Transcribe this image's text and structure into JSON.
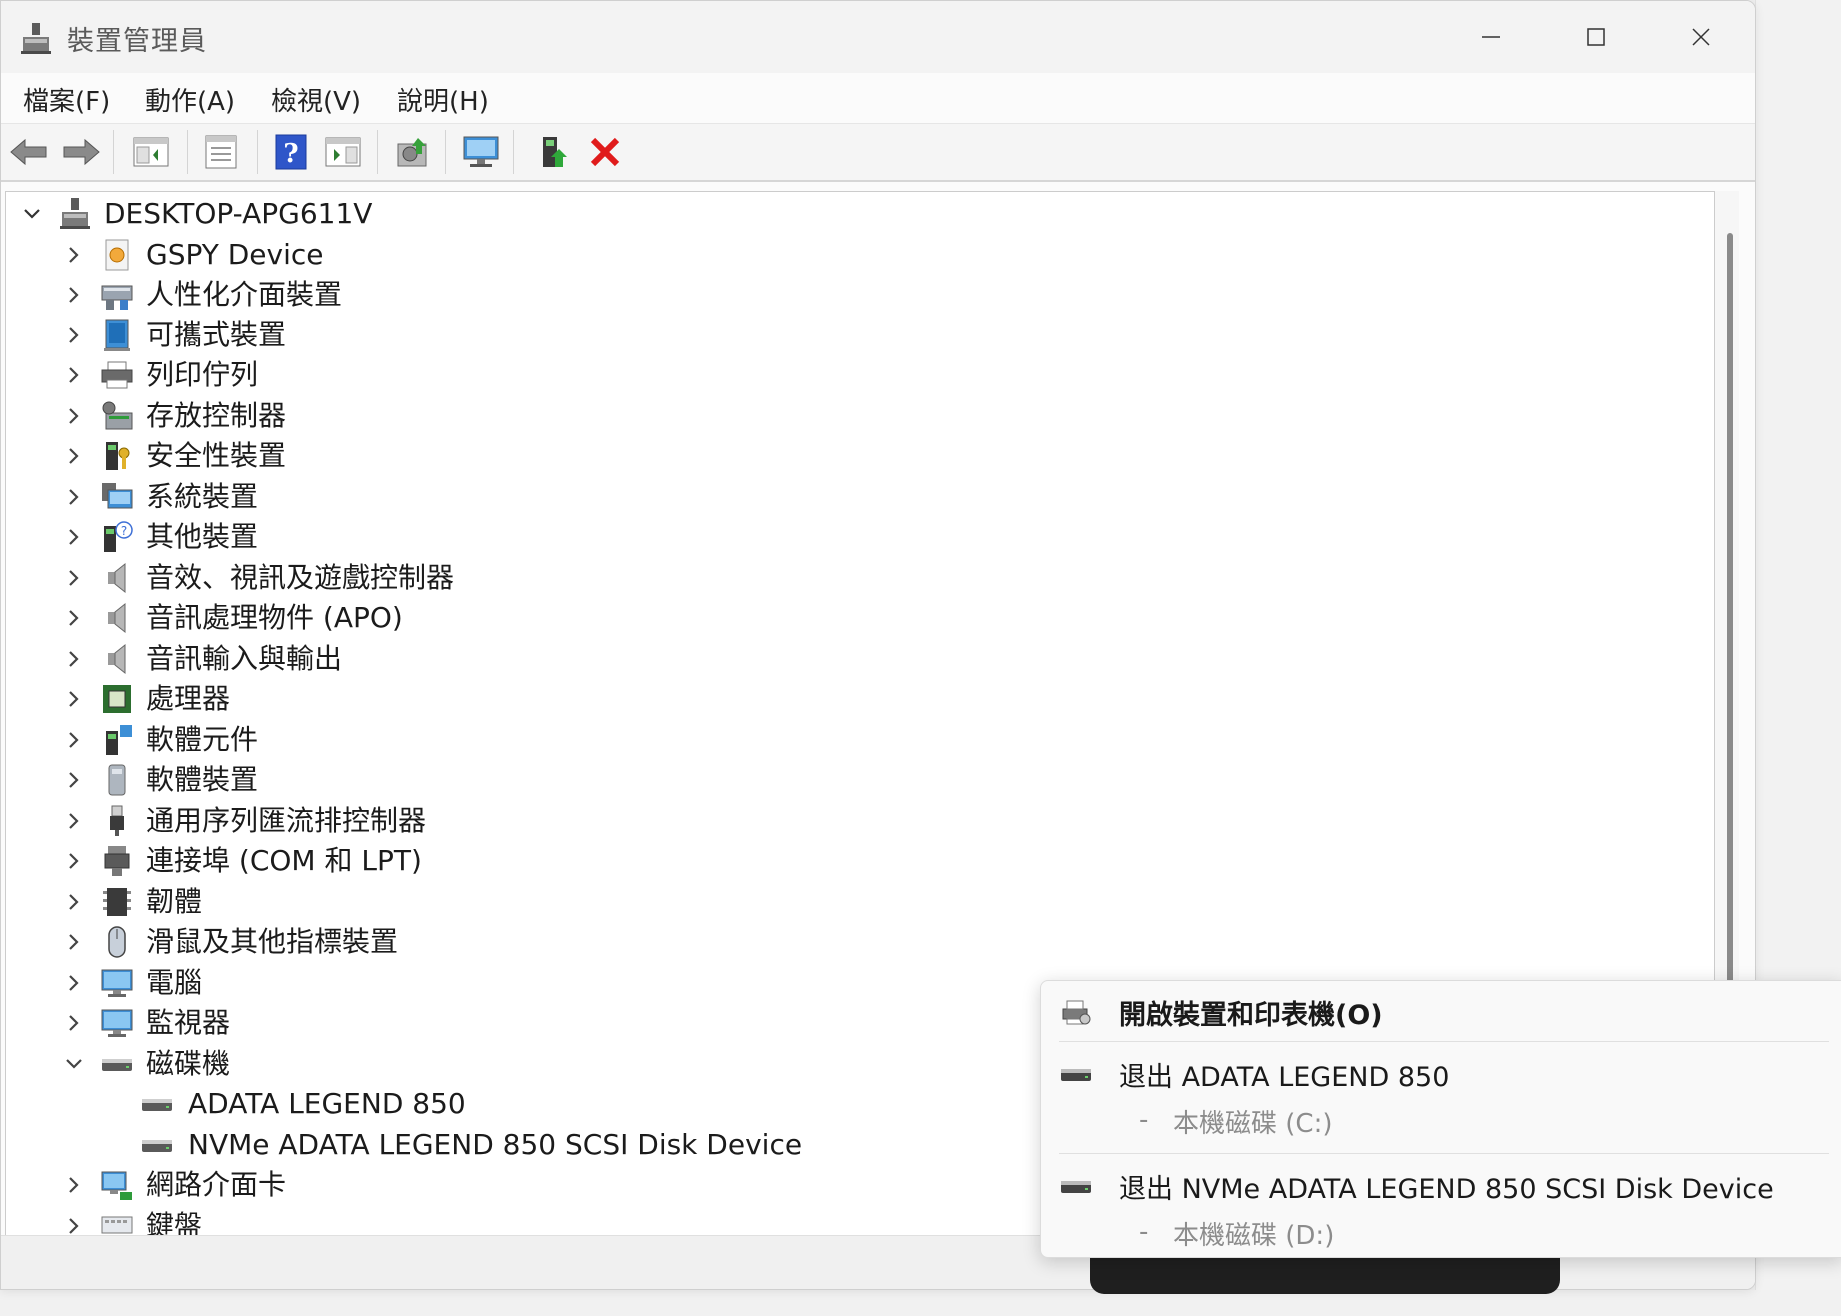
{
  "window": {
    "title": "裝置管理員",
    "controls": {
      "minimize": "minimize-icon",
      "maximize": "maximize-icon",
      "close": "close-icon"
    }
  },
  "menu": [
    "檔案(F)",
    "動作(A)",
    "檢視(V)",
    "說明(H)"
  ],
  "toolbar": {
    "buttons": [
      "back",
      "forward",
      "show-hide-console-tree",
      "properties",
      "help",
      "action-pane",
      "scan-hardware-changes",
      "device-monitor",
      "update-driver",
      "uninstall-device"
    ]
  },
  "tree": {
    "root": "DESKTOP-APG611V",
    "categories": [
      {
        "label": "GSPY Device",
        "icon": "gspy-icon",
        "expanded": false
      },
      {
        "label": "人性化介面裝置",
        "icon": "hid-icon",
        "expanded": false
      },
      {
        "label": "可攜式裝置",
        "icon": "portable-device-icon",
        "expanded": false
      },
      {
        "label": "列印佇列",
        "icon": "printer-icon",
        "expanded": false
      },
      {
        "label": "存放控制器",
        "icon": "storage-controller-icon",
        "expanded": false
      },
      {
        "label": "安全性裝置",
        "icon": "security-device-icon",
        "expanded": false
      },
      {
        "label": "系統裝置",
        "icon": "system-device-icon",
        "expanded": false
      },
      {
        "label": "其他裝置",
        "icon": "other-device-icon",
        "expanded": false
      },
      {
        "label": "音效、視訊及遊戲控制器",
        "icon": "speaker-icon",
        "expanded": false
      },
      {
        "label": "音訊處理物件 (APO)",
        "icon": "speaker-icon",
        "expanded": false
      },
      {
        "label": "音訊輸入與輸出",
        "icon": "speaker-icon",
        "expanded": false
      },
      {
        "label": "處理器",
        "icon": "processor-icon",
        "expanded": false
      },
      {
        "label": "軟體元件",
        "icon": "software-component-icon",
        "expanded": false
      },
      {
        "label": "軟體裝置",
        "icon": "software-device-icon",
        "expanded": false
      },
      {
        "label": "通用序列匯流排控制器",
        "icon": "usb-icon",
        "expanded": false
      },
      {
        "label": "連接埠 (COM 和 LPT)",
        "icon": "port-icon",
        "expanded": false
      },
      {
        "label": "韌體",
        "icon": "firmware-icon",
        "expanded": false
      },
      {
        "label": "滑鼠及其他指標裝置",
        "icon": "mouse-icon",
        "expanded": false
      },
      {
        "label": "電腦",
        "icon": "computer-icon",
        "expanded": false
      },
      {
        "label": "監視器",
        "icon": "monitor-icon",
        "expanded": false
      },
      {
        "label": "磁碟機",
        "icon": "disk-drive-icon",
        "expanded": true
      },
      {
        "label": "網路介面卡",
        "icon": "network-adapter-icon",
        "expanded": false
      },
      {
        "label": "鍵盤",
        "icon": "keyboard-icon",
        "expanded": false
      }
    ],
    "disk_children": [
      "ADATA LEGEND 850",
      "NVMe ADATA LEGEND 850 SCSI Disk Device"
    ]
  },
  "flyout": {
    "open_label": "開啟裝置和印表機(O)",
    "items": [
      {
        "title": "退出 ADATA LEGEND 850",
        "dash": "-",
        "sub": "本機磁碟 (C:)"
      },
      {
        "title": "退出 NVMe ADATA LEGEND 850 SCSI Disk Device",
        "dash": "-",
        "sub": "本機磁碟 (D:)"
      }
    ]
  }
}
